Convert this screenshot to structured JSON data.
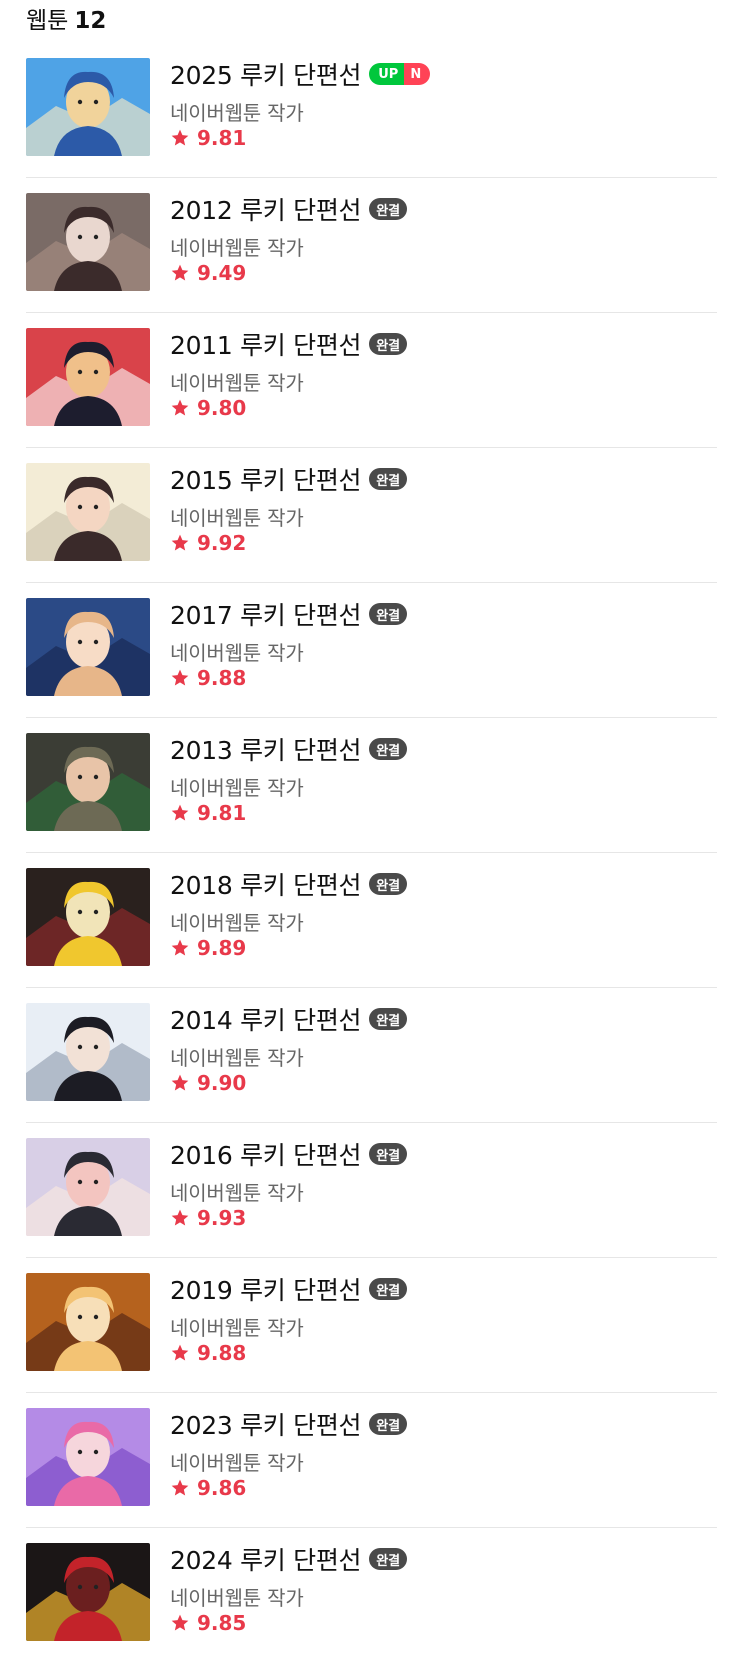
{
  "header": {
    "label": "웹툰",
    "count": "12"
  },
  "items": [
    {
      "title": "2025 루키 단편선",
      "author": "네이버웹툰 작가",
      "rating": "9.81",
      "badges": [
        "UP",
        "N"
      ],
      "thumb_colors": [
        "#4fa3e6",
        "#2c5aa8",
        "#f1d39b",
        "#e8e2c8"
      ]
    },
    {
      "title": "2012 루키 단편선",
      "author": "네이버웹툰 작가",
      "rating": "9.49",
      "badges": [
        "완결"
      ],
      "thumb_colors": [
        "#7a6b66",
        "#3b2b2b",
        "#e9d7cf",
        "#a48a80"
      ]
    },
    {
      "title": "2011 루키 단편선",
      "author": "네이버웹툰 작가",
      "rating": "9.80",
      "badges": [
        "완결"
      ],
      "thumb_colors": [
        "#d9434a",
        "#1d1d2e",
        "#f0c08a",
        "#f7e0e0"
      ]
    },
    {
      "title": "2015 루키 단편선",
      "author": "네이버웹툰 작가",
      "rating": "9.92",
      "badges": [
        "완결"
      ],
      "thumb_colors": [
        "#f3ecd6",
        "#3a2a2a",
        "#f4d6c2",
        "#cfc8b0"
      ]
    },
    {
      "title": "2017 루키 단편선",
      "author": "네이버웹툰 작가",
      "rating": "9.88",
      "badges": [
        "완결"
      ],
      "thumb_colors": [
        "#2b4a86",
        "#e7b689",
        "#f7dcc6",
        "#1a2a55"
      ]
    },
    {
      "title": "2013 루키 단편선",
      "author": "네이버웹툰 작가",
      "rating": "9.81",
      "badges": [
        "완결"
      ],
      "thumb_colors": [
        "#3b3d35",
        "#6d6a55",
        "#e8c4a8",
        "#2d6b3a"
      ]
    },
    {
      "title": "2018 루키 단편선",
      "author": "네이버웹툰 작가",
      "rating": "9.89",
      "badges": [
        "완결"
      ],
      "thumb_colors": [
        "#2a211e",
        "#f0c72e",
        "#f1e4b8",
        "#8a2a2a"
      ]
    },
    {
      "title": "2014 루키 단편선",
      "author": "네이버웹툰 작가",
      "rating": "9.90",
      "badges": [
        "완결"
      ],
      "thumb_colors": [
        "#e8eef5",
        "#1c1c24",
        "#f2e1d6",
        "#9aa5b6"
      ]
    },
    {
      "title": "2016 루키 단편선",
      "author": "네이버웹툰 작가",
      "rating": "9.93",
      "badges": [
        "완결"
      ],
      "thumb_colors": [
        "#d8cfe6",
        "#2a2a33",
        "#f3c5c0",
        "#f7e6e0"
      ]
    },
    {
      "title": "2019 루키 단편선",
      "author": "네이버웹툰 작가",
      "rating": "9.88",
      "badges": [
        "완결"
      ],
      "thumb_colors": [
        "#b5621e",
        "#f3c374",
        "#f7dfb8",
        "#5b2a14"
      ]
    },
    {
      "title": "2023 루키 단편선",
      "author": "네이버웹툰 작가",
      "rating": "9.86",
      "badges": [
        "완결"
      ],
      "thumb_colors": [
        "#b48be6",
        "#e96aa7",
        "#f6d6dc",
        "#7c4cc6"
      ]
    },
    {
      "title": "2024 루키 단편선",
      "author": "네이버웹툰 작가",
      "rating": "9.85",
      "badges": [
        "완결"
      ],
      "thumb_colors": [
        "#1b1616",
        "#c3232a",
        "#6b1f1f",
        "#f0b32e"
      ]
    }
  ]
}
